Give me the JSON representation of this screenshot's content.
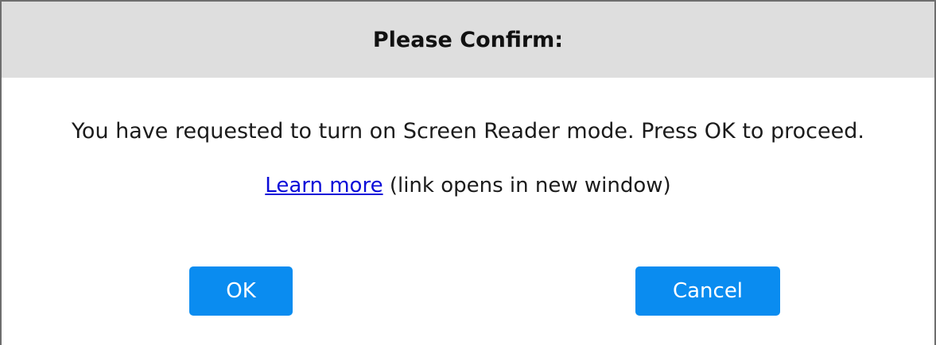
{
  "dialog": {
    "title": "Please Confirm:",
    "message": "You have requested to turn on Screen Reader mode. Press OK to proceed.",
    "learn_more_link": "Learn more",
    "learn_more_note": "(link opens in new window)",
    "ok_label": "OK",
    "cancel_label": "Cancel"
  },
  "colors": {
    "header_bg": "#dedede",
    "button_bg": "#0a8cf0",
    "link": "#0b0bd8",
    "border": "#6e6e6e"
  }
}
